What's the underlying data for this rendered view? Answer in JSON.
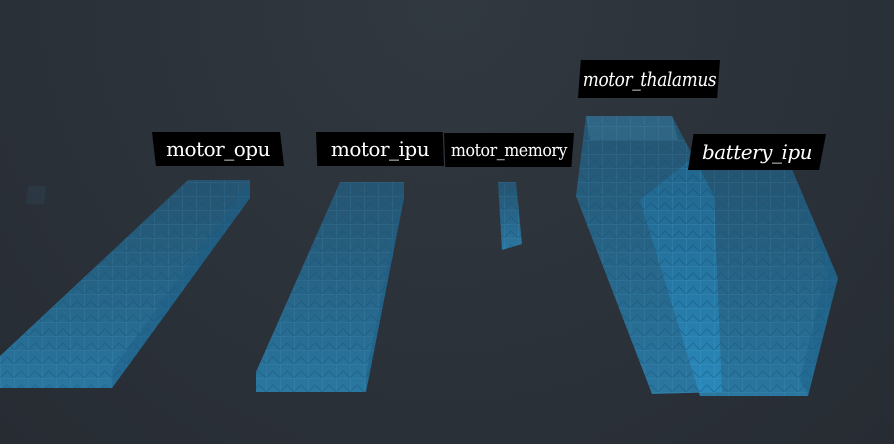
{
  "viewport": {
    "background_color": "#2b3139",
    "voxel_color": "#2a8fc4"
  },
  "regions": [
    {
      "id": "motor_opu",
      "label": "motor_opu"
    },
    {
      "id": "motor_ipu",
      "label": "motor_ipu"
    },
    {
      "id": "motor_memory",
      "label": "motor_memory"
    },
    {
      "id": "motor_thalamus",
      "label": "motor_thalamus"
    },
    {
      "id": "battery_ipu",
      "label": "battery_ipu"
    }
  ]
}
